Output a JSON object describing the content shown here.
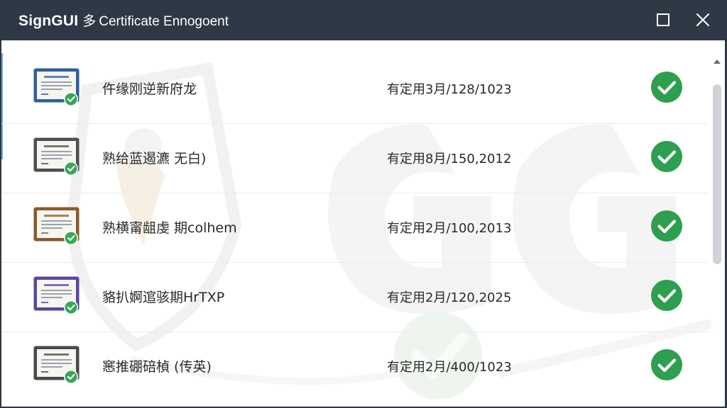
{
  "window": {
    "app_name": "SignGUI",
    "title_sep": "多",
    "title_sub": "Certificate Ennogoent"
  },
  "certificates": [
    {
      "name": "仵缘刚逆新府龙",
      "date": "有定用3月/128/1023",
      "frame_color": "#2f5f9e",
      "status": "valid"
    },
    {
      "name": "熟给蓝遏瀌 无白)",
      "date": "有定用8月/150,2012",
      "frame_color": "#4f4f4f",
      "status": "valid"
    },
    {
      "name": "熟横甯龃虔 期colhem",
      "date": "有定用2月/100,2013",
      "frame_color": "#8a5a2b",
      "status": "valid"
    },
    {
      "name": "貉扒婀逭骇期HrTXP",
      "date": "有定用2月/120,2025",
      "frame_color": "#5a46a0",
      "status": "valid"
    },
    {
      "name": "窸推硼碚楨 (传英)",
      "date": "有定用2月/400/1023",
      "frame_color": "#4a4a4a",
      "status": "valid"
    }
  ],
  "colors": {
    "titlebar": "#2f3845",
    "check_green": "#2e9e4f",
    "badge_green": "#34a853"
  },
  "icons": {
    "maximize": "maximize-icon",
    "close": "close-icon",
    "certificate": "certificate-icon",
    "check": "check-circle-icon",
    "scroll_up": "chevron-up-icon"
  }
}
